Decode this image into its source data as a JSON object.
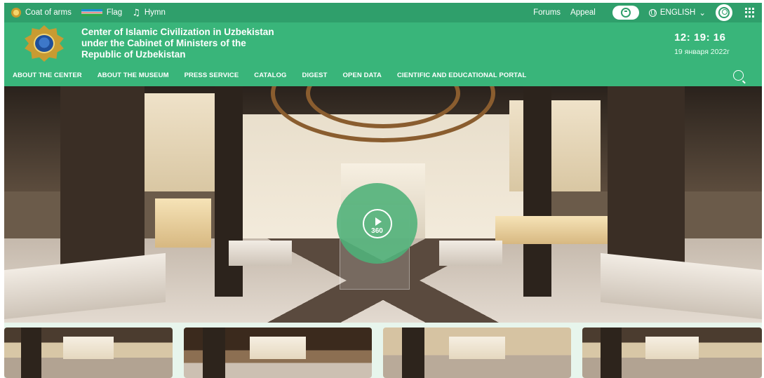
{
  "topbar": {
    "coat_of_arms": "Coat of arms",
    "flag": "Flag",
    "hymn": "Hymn",
    "forums": "Forums",
    "appeal": "Appeal",
    "language": "ENGLISH",
    "language_chevron": "⌄",
    "hymn_icon": "♫"
  },
  "header": {
    "title_line1": "Center of Islamic Civilization in Uzbekistan",
    "title_line2": "under the Cabinet of Ministers of the",
    "title_line3": "Republic of Uzbekistan",
    "time": "12: 19: 16",
    "date": "19 января 2022г"
  },
  "nav": {
    "items": [
      "ABOUT THE CENTER",
      "ABOUT THE MUSEUM",
      "PRESS SERVICE",
      "CATALOG",
      "DIGEST",
      "OPEN DATA",
      "CIENTIFIC AND EDUCATIONAL PORTAL"
    ]
  },
  "hero": {
    "play_label": "360"
  },
  "icons": {
    "coat_of_arms": "emblem-icon",
    "flag": "flag-icon",
    "hymn": "music-note-icon",
    "accessibility": "accessibility-icon",
    "language": "globe-icon",
    "user": "user-icon",
    "apps": "grid-icon",
    "search": "search-icon",
    "play": "play-icon"
  },
  "colors": {
    "topbar": "#2f9f6b",
    "header": "#39b57a",
    "overlay": "#4db078",
    "thumb_strip": "#e7f5ec"
  }
}
